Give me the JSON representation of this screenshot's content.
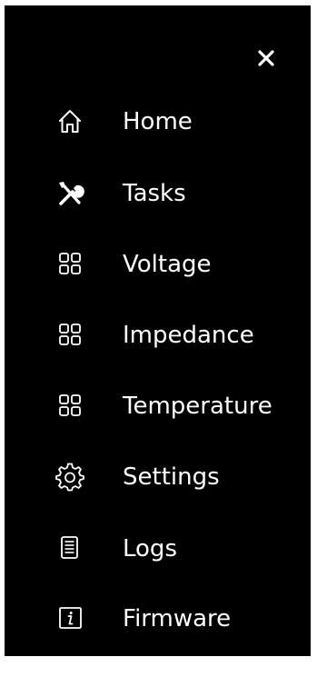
{
  "menu": {
    "close_icon": "close-icon",
    "background_color": "#000000",
    "text_color": "#ffffff",
    "items": [
      {
        "label": "Home",
        "icon": "home-icon"
      },
      {
        "label": "Tasks",
        "icon": "tools-icon"
      },
      {
        "label": "Voltage",
        "icon": "grid-icon"
      },
      {
        "label": "Impedance",
        "icon": "grid-icon"
      },
      {
        "label": "Temperature",
        "icon": "grid-icon"
      },
      {
        "label": "Settings",
        "icon": "gear-icon"
      },
      {
        "label": "Logs",
        "icon": "document-icon"
      },
      {
        "label": "Firmware",
        "icon": "info-icon"
      }
    ]
  }
}
